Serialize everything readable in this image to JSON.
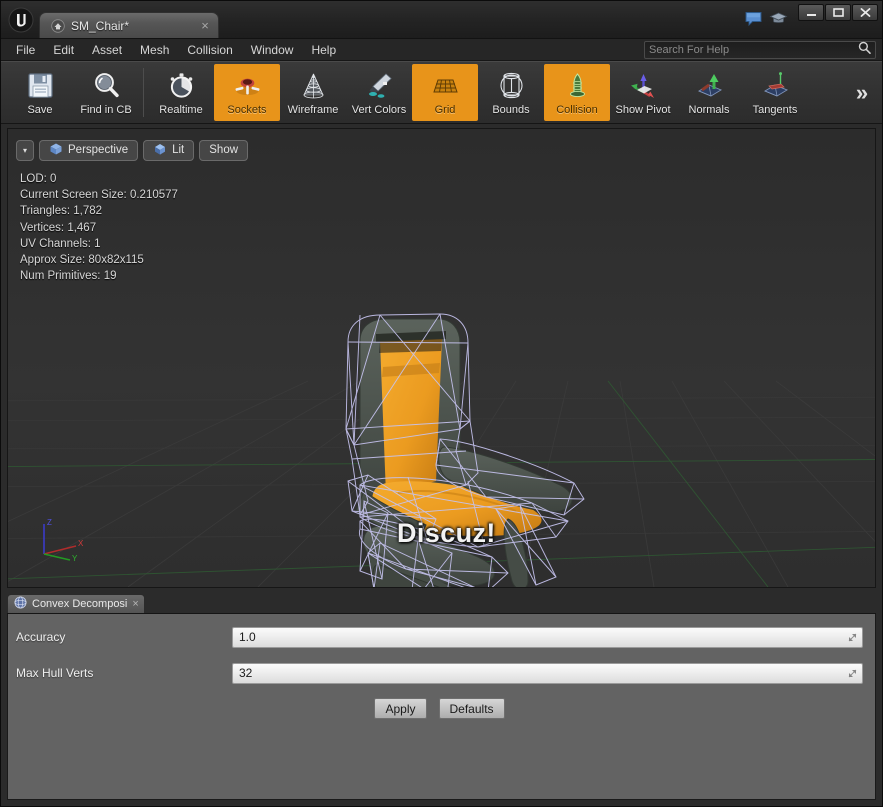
{
  "window": {
    "app_logo": "unreal-engine-logo",
    "document_tab": {
      "label": "SM_Chair*",
      "icon": "asset-icon",
      "close": "×"
    },
    "controls": {
      "minimize": "minimize-icon",
      "maximize": "maximize-icon",
      "close": "close-icon"
    },
    "help_icons": {
      "feedback": "feedback-bubble-icon",
      "tutorial": "graduation-cap-icon"
    }
  },
  "menubar": {
    "items": [
      {
        "label": "File"
      },
      {
        "label": "Edit"
      },
      {
        "label": "Asset"
      },
      {
        "label": "Mesh"
      },
      {
        "label": "Collision"
      },
      {
        "label": "Window"
      },
      {
        "label": "Help"
      }
    ]
  },
  "search": {
    "placeholder": "Search For Help",
    "value": "",
    "icon": "search-icon"
  },
  "toolbar": {
    "groups": [
      {
        "buttons": [
          {
            "label": "Save",
            "icon": "floppy-disk-icon",
            "active": false
          },
          {
            "label": "Find in CB",
            "icon": "magnifier-icon",
            "active": false
          }
        ]
      },
      {
        "buttons": [
          {
            "label": "Realtime",
            "icon": "stopwatch-icon",
            "active": false
          },
          {
            "label": "Sockets",
            "icon": "socket-icon",
            "active": true
          },
          {
            "label": "Wireframe",
            "icon": "wireframe-cone-icon",
            "active": false
          },
          {
            "label": "Vert Colors",
            "icon": "paintbrush-icon",
            "active": false
          },
          {
            "label": "Grid",
            "icon": "grid-icon",
            "active": true
          },
          {
            "label": "Bounds",
            "icon": "bounds-icon",
            "active": false
          },
          {
            "label": "Collision",
            "icon": "collision-icon",
            "active": true
          },
          {
            "label": "Show Pivot",
            "icon": "pivot-axes-icon",
            "active": false
          },
          {
            "label": "Normals",
            "icon": "normals-icon",
            "active": false
          },
          {
            "label": "Tangents",
            "icon": "tangents-icon",
            "active": false
          }
        ]
      }
    ],
    "overflow_label": "»"
  },
  "viewport": {
    "controls": {
      "menu_caret": "▾",
      "view_mode": {
        "label": "Perspective",
        "icon": "camera-perspective-icon"
      },
      "lighting": {
        "label": "Lit",
        "icon": "lit-shading-icon"
      },
      "show": {
        "label": "Show"
      }
    },
    "stats": [
      {
        "key": "LOD:",
        "value": "0"
      },
      {
        "key": "Current Screen Size:",
        "value": "0.210577"
      },
      {
        "key": "Triangles:",
        "value": "1,782"
      },
      {
        "key": "Vertices:",
        "value": "1,467"
      },
      {
        "key": "UV Channels:",
        "value": "1"
      },
      {
        "key": "Approx Size:",
        "value": "80x82x115"
      },
      {
        "key": "Num Primitives:",
        "value": "19"
      }
    ],
    "watermark": "Discuz!",
    "axis_gizmo": {
      "x": "X",
      "y": "Y",
      "z": "Z"
    },
    "colors": {
      "background": "#313131",
      "grid_line": "#3f3f3f",
      "grid_green": "#2f5b33",
      "mesh_cushion": "#eb9b20",
      "mesh_frame": "#4d544e",
      "collision_wire": "#c6c3ef"
    }
  },
  "details_panel": {
    "tab": {
      "label": "Convex Decomposi",
      "icon": "sphere-icon",
      "close": "×"
    },
    "properties": [
      {
        "label": "Accuracy",
        "value": "1.0",
        "spinner": "drag-spinner-icon"
      },
      {
        "label": "Max Hull Verts",
        "value": "32",
        "spinner": "drag-spinner-icon"
      }
    ],
    "buttons": [
      {
        "label": "Apply"
      },
      {
        "label": "Defaults"
      }
    ]
  },
  "theme": {
    "accent_orange": "#e8941a",
    "panel_gray": "#636363",
    "chrome_dark": "#2b2b2b"
  }
}
